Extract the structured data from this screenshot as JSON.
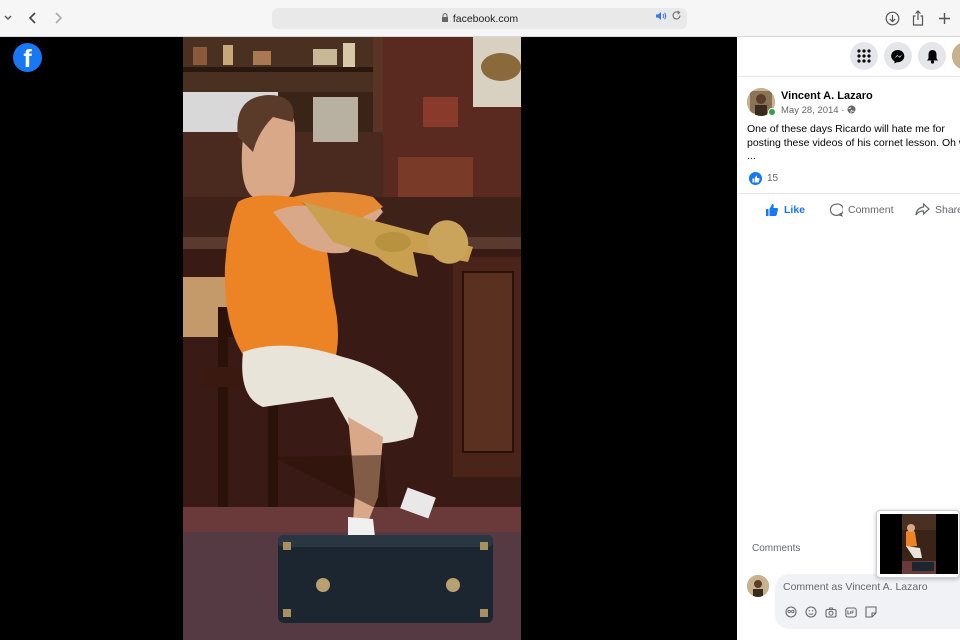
{
  "browser": {
    "url": "facebook.com",
    "icons": [
      "chevron-down-icon",
      "back-icon",
      "forward-icon",
      "lock-icon",
      "speaker-icon",
      "reload-icon",
      "download-icon",
      "share-icon",
      "new-tab-icon"
    ]
  },
  "header": {
    "logo_letter": "f",
    "icons": [
      "menu-grid-icon",
      "messenger-icon",
      "notifications-icon",
      "profile-avatar"
    ]
  },
  "post": {
    "author": "Vincent A. Lazaro",
    "date": "May 28, 2014 · ",
    "privacy_icon": "globe-icon",
    "text": "One of these days Ricardo will hate me for posting these videos of his cornet lesson. Oh well ...",
    "reaction_count": "15",
    "actions": {
      "like": "Like",
      "comment": "Comment",
      "share": "Share"
    }
  },
  "comments": {
    "label": "Comments",
    "placeholder": "Comment as Vincent A. Lazaro",
    "tool_icons": [
      "avatar-sticker-icon",
      "emoji-icon",
      "camera-icon",
      "gif-icon",
      "sticker-icon"
    ]
  },
  "colors": {
    "accent": "#1877f2",
    "background": "#000000",
    "panel": "#ffffff"
  }
}
